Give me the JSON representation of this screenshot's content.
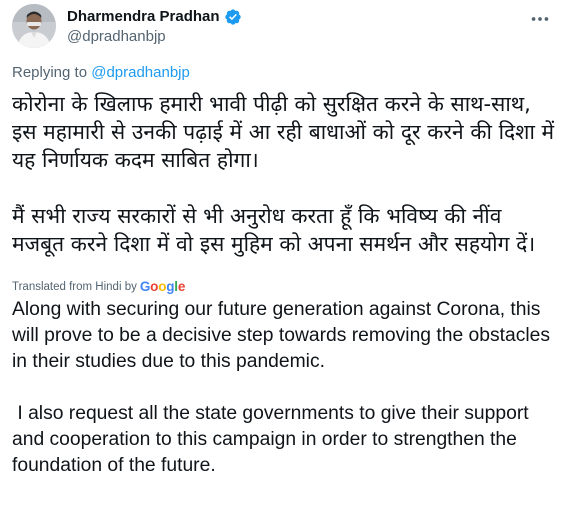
{
  "author": {
    "display_name": "Dharmendra Pradhan",
    "handle": "@dpradhanbjp",
    "verified": true
  },
  "icons": {
    "verified": "verified-badge-icon",
    "more": "more-options-icon",
    "avatar": "profile-photo"
  },
  "colors": {
    "link": "#1d9bf0",
    "secondary_text": "#536471",
    "primary_text": "#0f1419",
    "google_blue": "#4285F4",
    "google_red": "#EA4335",
    "google_yellow": "#FBBC05",
    "google_green": "#34A853"
  },
  "reply": {
    "prefix": "Replying to",
    "to": "@dpradhanbjp"
  },
  "original_text": {
    "paragraph1": "कोरोना के खिलाफ हमारी भावी पीढ़ी को सुरक्षित करने के साथ-साथ, इस महामारी से उनकी पढ़ाई में आ रही बाधाओं को दूर करने की दिशा में यह निर्णायक कदम साबित होगा।",
    "paragraph2": "मैं सभी राज्य सरकारों से भी अनुरोध करता हूँ कि भविष्य की नींव मजबूत करने दिशा में वो इस मुहिम को अपना समर्थन और सहयोग दें।"
  },
  "translation": {
    "label": "Translated from Hindi by",
    "provider": "Google",
    "paragraph1": "Along with securing our future generation against Corona, this will prove to be a decisive step towards removing the obstacles in their studies due to this pandemic.",
    "paragraph2": " I also request all the state governments to give their support and cooperation to this campaign in order to strengthen the foundation of the future."
  }
}
